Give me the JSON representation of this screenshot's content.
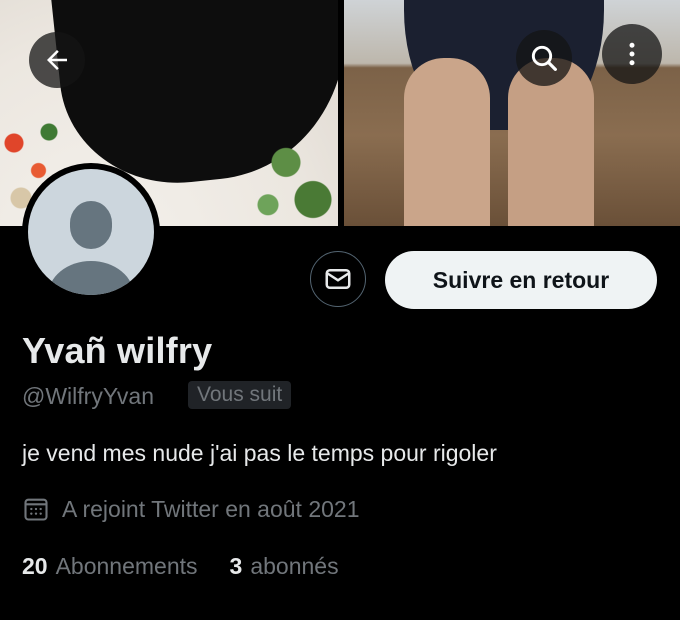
{
  "header": {
    "back_icon": "arrow-left-icon",
    "search_icon": "search-icon",
    "more_icon": "more-vertical-icon"
  },
  "profile": {
    "display_name": "Yvañ wilfry",
    "handle": "@WilfryYvan",
    "follows_you_badge": "Vous suit",
    "bio": "je vend mes nude j'ai pas le temps pour rigoler",
    "joined": "A rejoint Twitter en août 2021",
    "following_count": "20",
    "following_label": "Abonnements",
    "followers_count": "3",
    "followers_label": "abonnés"
  },
  "actions": {
    "message_icon": "mail-icon",
    "follow_back_label": "Suivre en retour"
  },
  "colors": {
    "background": "#000000",
    "primary_text": "#e7e9ea",
    "secondary_text": "#71767b",
    "button_bg": "#eff3f4"
  }
}
